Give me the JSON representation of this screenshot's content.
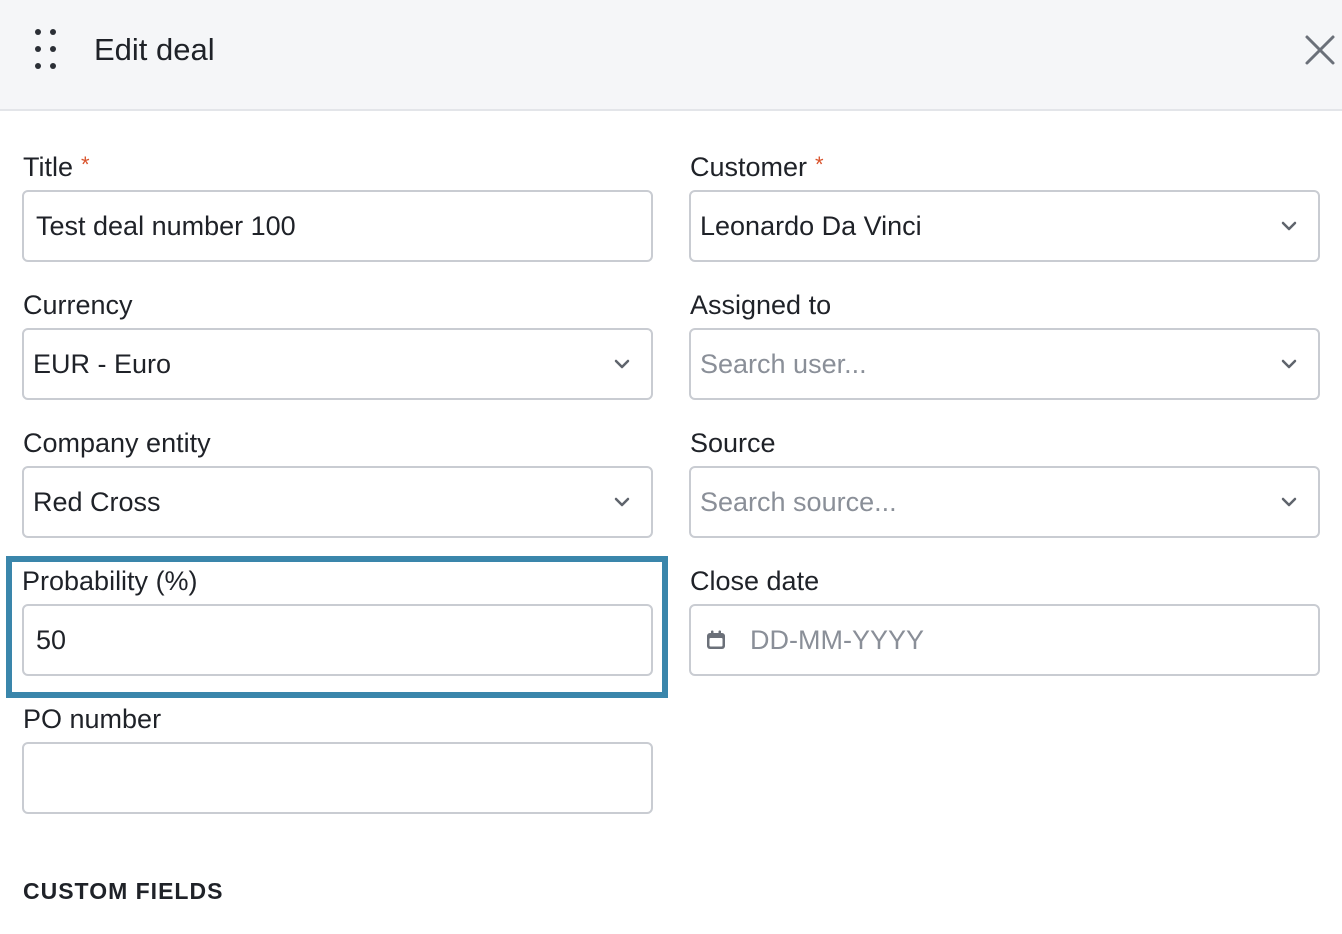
{
  "dialog": {
    "title": "Edit deal",
    "section_heading": "CUSTOM FIELDS",
    "accent_color": "#3a86ab",
    "required_color": "#d9532c"
  },
  "fields": {
    "title": {
      "label": "Title",
      "required_mark": "*",
      "value": "Test deal number 100"
    },
    "customer": {
      "label": "Customer",
      "required_mark": "*",
      "value": "Leonardo Da Vinci"
    },
    "currency": {
      "label": "Currency",
      "value": "EUR - Euro"
    },
    "assigned_to": {
      "label": "Assigned to",
      "placeholder": "Search user..."
    },
    "company_entity": {
      "label": "Company entity",
      "value": "Red Cross"
    },
    "source": {
      "label": "Source",
      "placeholder": "Search source..."
    },
    "probability": {
      "label": "Probability (%)",
      "value": "50"
    },
    "close_date": {
      "label": "Close date",
      "placeholder": "DD-MM-YYYY"
    },
    "po_number": {
      "label": "PO number",
      "value": ""
    }
  },
  "icons": {
    "drag": "drag-handle-icon",
    "close": "close-icon",
    "dropdown": "chevron-down-icon",
    "calendar": "calendar-icon"
  }
}
